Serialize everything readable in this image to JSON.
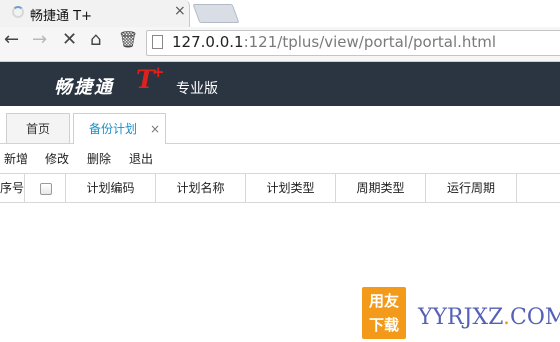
{
  "browser": {
    "tab_title": "畅捷通 T+",
    "tab_close": "×",
    "url_host": "127.0.0.1",
    "url_rest": ":121/tplus/view/portal/portal.html"
  },
  "app": {
    "logo_text": "畅捷通",
    "logo_t": "T",
    "logo_plus": "+",
    "logo_edition": "专业版"
  },
  "tabs": {
    "home": "首页",
    "backup": "备份计划",
    "close": "×"
  },
  "toolbar": {
    "add": "新增",
    "edit": "修改",
    "delete": "删除",
    "exit": "退出"
  },
  "grid": {
    "columns": [
      "序号",
      "",
      "计划编码",
      "计划名称",
      "计划类型",
      "周期类型",
      "运行周期"
    ]
  },
  "watermark": {
    "cn_text": "用友下载",
    "url_main": "YYRJXZ",
    "url_dot": ".",
    "url_tld": "COM",
    "color_orange": "#f39a1a",
    "color_blue": "#5560b6"
  }
}
